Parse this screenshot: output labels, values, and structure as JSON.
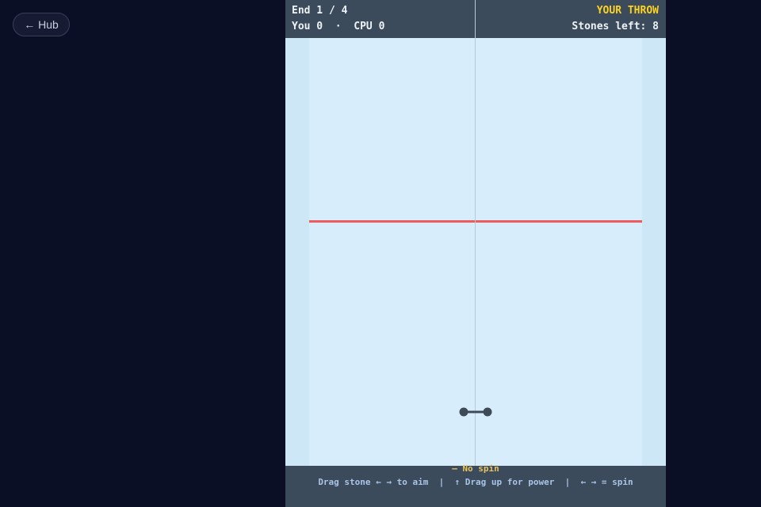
{
  "nav": {
    "hub_label": "← Hub"
  },
  "hud": {
    "end": "End 1 / 4",
    "score": "You 0  ·  CPU 0",
    "turn": "YOUR THROW",
    "stones_left": "Stones left: 8"
  },
  "colors": {
    "background": "#0b0f26",
    "hud": "#3b4b5c",
    "turn": "#ffd21f",
    "ice": "#d8edfb",
    "hog_line": "#ef5a5a",
    "stone": "#3f4a57"
  },
  "footer": {
    "spin": "— No spin",
    "instructions": "Drag stone ← → to aim  |  ↑ Drag up for power  |  ← → = spin"
  }
}
